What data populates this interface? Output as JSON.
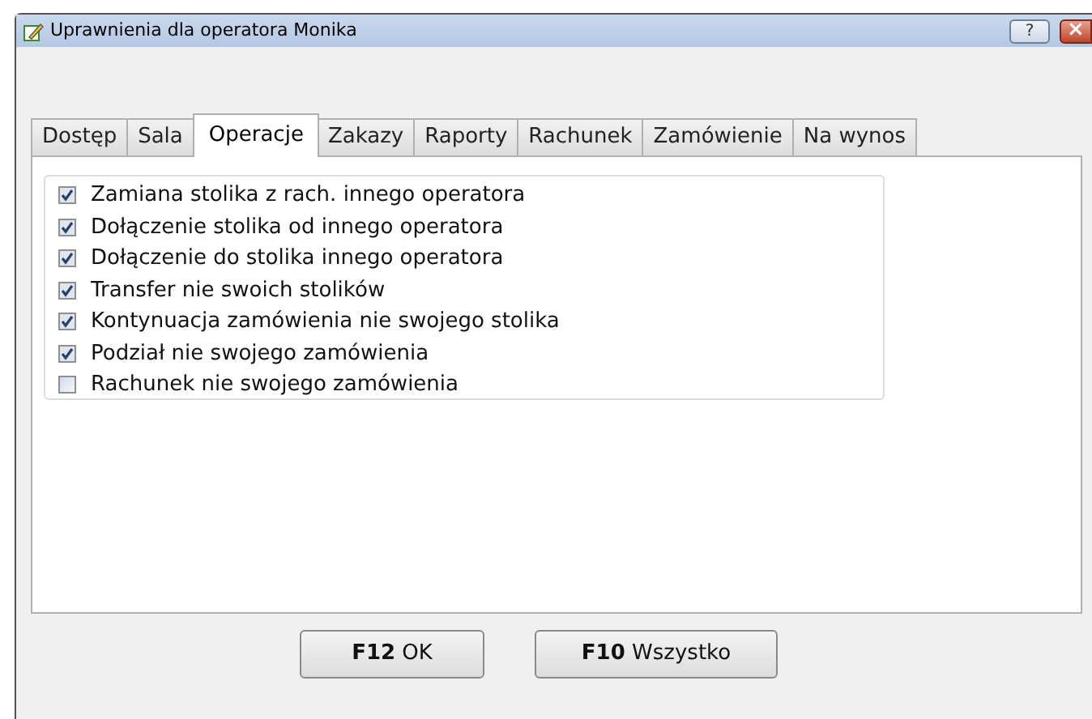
{
  "window": {
    "title": "Uprawnienia dla operatora Monika",
    "help": "?",
    "close": "×"
  },
  "tabs": [
    {
      "label": "Dostęp",
      "selected": false
    },
    {
      "label": "Sala",
      "selected": false
    },
    {
      "label": "Operacje",
      "selected": true
    },
    {
      "label": "Zakazy",
      "selected": false
    },
    {
      "label": "Raporty",
      "selected": false
    },
    {
      "label": "Rachunek",
      "selected": false
    },
    {
      "label": "Zamówienie",
      "selected": false
    },
    {
      "label": "Na wynos",
      "selected": false
    }
  ],
  "permissions": [
    {
      "label": "Zamiana stolika z rach. innego operatora",
      "checked": true
    },
    {
      "label": "Dołączenie stolika od innego operatora",
      "checked": true
    },
    {
      "label": "Dołączenie do stolika innego operatora",
      "checked": true
    },
    {
      "label": "Transfer nie swoich stolików",
      "checked": true
    },
    {
      "label": "Kontynuacja zamówienia nie swojego stolika",
      "checked": true
    },
    {
      "label": "Podział nie swojego zamówienia",
      "checked": true
    },
    {
      "label": "Rachunek nie swojego zamówienia",
      "checked": false
    }
  ],
  "buttons": [
    {
      "label": "**F12** OK"
    },
    {
      "label": "**F10** Wszystko"
    }
  ]
}
